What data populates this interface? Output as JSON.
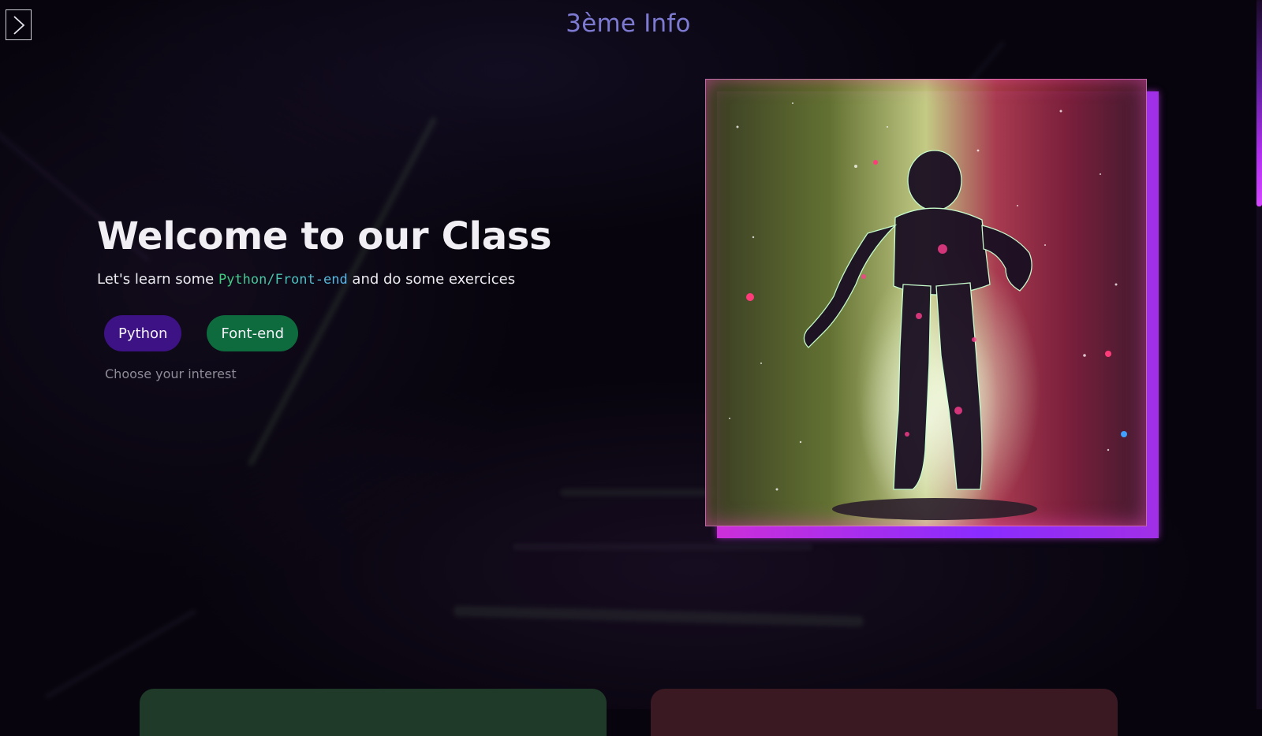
{
  "header": {
    "title": "3ème Info",
    "menu_icon": "chevron-right-icon"
  },
  "hero": {
    "heading": "Welcome to our Class",
    "subtitle_before": "Let's learn some ",
    "subtitle_code": "Python/Front-end",
    "subtitle_after": " and do some exercices",
    "hint": "Choose your interest"
  },
  "buttons": [
    {
      "label": "Python",
      "color": "#3d1285"
    },
    {
      "label": "Font-end",
      "color": "#0d6b3e"
    }
  ],
  "illustration": {
    "subject": "glowing astronaut robot in space",
    "accent": "#cc2fd9"
  },
  "cards": [
    {
      "title": "",
      "color": "#1f3a29"
    },
    {
      "title": "",
      "color": "#3a1923"
    }
  ],
  "colors": {
    "background": "#07040d",
    "title": "#7d7ad2",
    "scrollbar": "#b22ff0"
  }
}
